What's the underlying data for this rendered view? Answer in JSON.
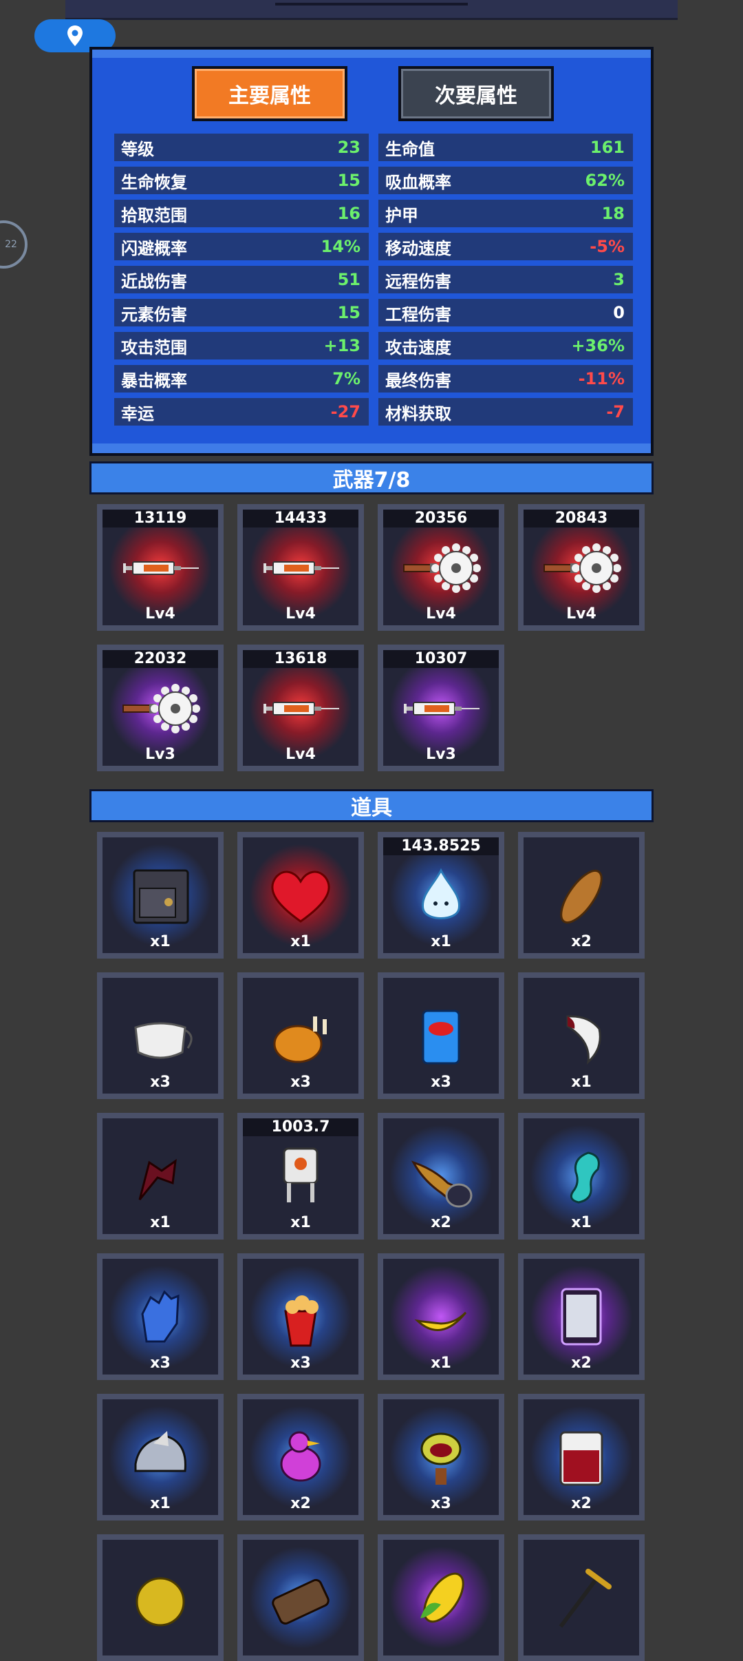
{
  "primary_tab": "主要属性",
  "secondary_tab": "次要属性",
  "stats_left": [
    {
      "label": "等级",
      "value": "23",
      "tone": "pos"
    },
    {
      "label": "生命恢复",
      "value": "15",
      "tone": "pos"
    },
    {
      "label": "拾取范围",
      "value": "16",
      "tone": "pos"
    },
    {
      "label": "闪避概率",
      "value": "14%",
      "tone": "pos"
    },
    {
      "label": "近战伤害",
      "value": "51",
      "tone": "pos"
    },
    {
      "label": "元素伤害",
      "value": "15",
      "tone": "pos"
    },
    {
      "label": "攻击范围",
      "value": "+13",
      "tone": "pos"
    },
    {
      "label": "暴击概率",
      "value": "7%",
      "tone": "pos"
    },
    {
      "label": "幸运",
      "value": "-27",
      "tone": "neg"
    }
  ],
  "stats_right": [
    {
      "label": "生命值",
      "value": "161",
      "tone": "pos"
    },
    {
      "label": "吸血概率",
      "value": "62%",
      "tone": "pos"
    },
    {
      "label": "护甲",
      "value": "18",
      "tone": "pos"
    },
    {
      "label": "移动速度",
      "value": "-5%",
      "tone": "neg"
    },
    {
      "label": "远程伤害",
      "value": "3",
      "tone": "pos"
    },
    {
      "label": "工程伤害",
      "value": "0",
      "tone": "neu"
    },
    {
      "label": "攻击速度",
      "value": "+36%",
      "tone": "pos"
    },
    {
      "label": "最终伤害",
      "value": "-11%",
      "tone": "neg"
    },
    {
      "label": "材料获取",
      "value": "-7",
      "tone": "neg"
    }
  ],
  "weapons_title": "武器7/8",
  "weapons": [
    {
      "damage": "13119",
      "level": "Lv4",
      "glow": "red",
      "icon": "syringe-icon"
    },
    {
      "damage": "14433",
      "level": "Lv4",
      "glow": "red",
      "icon": "syringe-icon"
    },
    {
      "damage": "20356",
      "level": "Lv4",
      "glow": "red",
      "icon": "sawblade-icon"
    },
    {
      "damage": "20843",
      "level": "Lv4",
      "glow": "red",
      "icon": "sawblade-icon"
    },
    {
      "damage": "22032",
      "level": "Lv3",
      "glow": "purple",
      "icon": "sawblade-icon"
    },
    {
      "damage": "13618",
      "level": "Lv4",
      "glow": "red",
      "icon": "syringe-icon"
    },
    {
      "damage": "10307",
      "level": "Lv3",
      "glow": "purple",
      "icon": "syringe-icon"
    }
  ],
  "items_title": "道具",
  "items": [
    {
      "tag": "",
      "count": "x1",
      "glow": "blue",
      "icon": "safe-icon"
    },
    {
      "tag": "",
      "count": "x1",
      "glow": "red",
      "icon": "heart-icon"
    },
    {
      "tag": "143.8525",
      "count": "x1",
      "glow": "blue",
      "icon": "water-spirit-icon"
    },
    {
      "tag": "",
      "count": "x2",
      "glow": "none",
      "icon": "bread-icon"
    },
    {
      "tag": "",
      "count": "x3",
      "glow": "none",
      "icon": "mask-icon"
    },
    {
      "tag": "",
      "count": "x3",
      "glow": "none",
      "icon": "roast-chicken-icon"
    },
    {
      "tag": "",
      "count": "x3",
      "glow": "none",
      "icon": "chips-bag-icon"
    },
    {
      "tag": "",
      "count": "x1",
      "glow": "none",
      "icon": "fang-icon"
    },
    {
      "tag": "",
      "count": "x1",
      "glow": "none",
      "icon": "bat-wing-icon"
    },
    {
      "tag": "1003.7",
      "count": "x1",
      "glow": "none",
      "icon": "robot-turret-icon"
    },
    {
      "tag": "",
      "count": "x2",
      "glow": "blue",
      "icon": "horn-icon"
    },
    {
      "tag": "",
      "count": "x1",
      "glow": "blue",
      "icon": "seahorse-icon"
    },
    {
      "tag": "",
      "count": "x3",
      "glow": "blue",
      "icon": "glove-icon"
    },
    {
      "tag": "",
      "count": "x3",
      "glow": "blue",
      "icon": "popcorn-icon"
    },
    {
      "tag": "",
      "count": "x1",
      "glow": "purple",
      "icon": "banana-icon"
    },
    {
      "tag": "",
      "count": "x2",
      "glow": "purple",
      "icon": "tablet-icon"
    },
    {
      "tag": "",
      "count": "x1",
      "glow": "blue",
      "icon": "helmet-icon"
    },
    {
      "tag": "",
      "count": "x2",
      "glow": "blue",
      "icon": "pink-bird-icon"
    },
    {
      "tag": "",
      "count": "x3",
      "glow": "blue",
      "icon": "man-eating-plant-icon"
    },
    {
      "tag": "",
      "count": "x2",
      "glow": "blue",
      "icon": "blood-jar-icon"
    },
    {
      "tag": "",
      "count": "",
      "glow": "none",
      "icon": "durian-icon"
    },
    {
      "tag": "",
      "count": "",
      "glow": "blue",
      "icon": "log-icon"
    },
    {
      "tag": "",
      "count": "",
      "glow": "purple",
      "icon": "corn-icon"
    },
    {
      "tag": "",
      "count": "",
      "glow": "none",
      "icon": "pickaxe-icon"
    }
  ]
}
